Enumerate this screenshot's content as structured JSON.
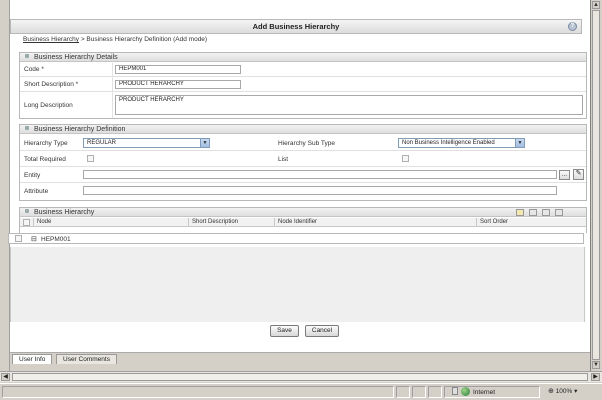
{
  "page": {
    "title": "Add Business Hierarchy",
    "help_icon": "help-icon",
    "breadcrumb": {
      "link": "Business Hierarchy",
      "separator": ">",
      "current": "Business Hierarchy Definition (Add mode)"
    }
  },
  "details": {
    "header": "Business Hierarchy Details",
    "code_label": "Code *",
    "code_value": "HEPM001",
    "short_desc_label": "Short Description *",
    "short_desc_value": "PRODUCT HERARCHY",
    "long_desc_label": "Long Description",
    "long_desc_value": "PRODUCT HERARCHY"
  },
  "definition": {
    "header": "Business Hierarchy Definition",
    "type_label": "Hierarchy Type",
    "type_value": "REGULAR",
    "subtype_label": "Hierarchy Sub Type",
    "subtype_value": "Non Business Intelligence Enabled",
    "total_required_label": "Total Required",
    "list_label": "List",
    "entity_label": "Entity",
    "entity_button": "...",
    "attribute_label": "Attribute"
  },
  "hierarchy": {
    "header": "Business Hierarchy",
    "columns": [
      "Node",
      "Short Description",
      "Node Identifier",
      "Sort Order"
    ],
    "tree_node": "HEPM001",
    "tree_toggle": "⊟"
  },
  "actions": {
    "save": "Save",
    "cancel": "Cancel"
  },
  "tabs": [
    "User Info",
    "User Comments"
  ],
  "status_bar": {
    "zone": "Internet",
    "zoom": "100%",
    "zoom_arrow": "▾"
  },
  "colors": {
    "panel_header": "#dedede",
    "select_border": "#7f9db9",
    "background": "#d4d0c8"
  }
}
